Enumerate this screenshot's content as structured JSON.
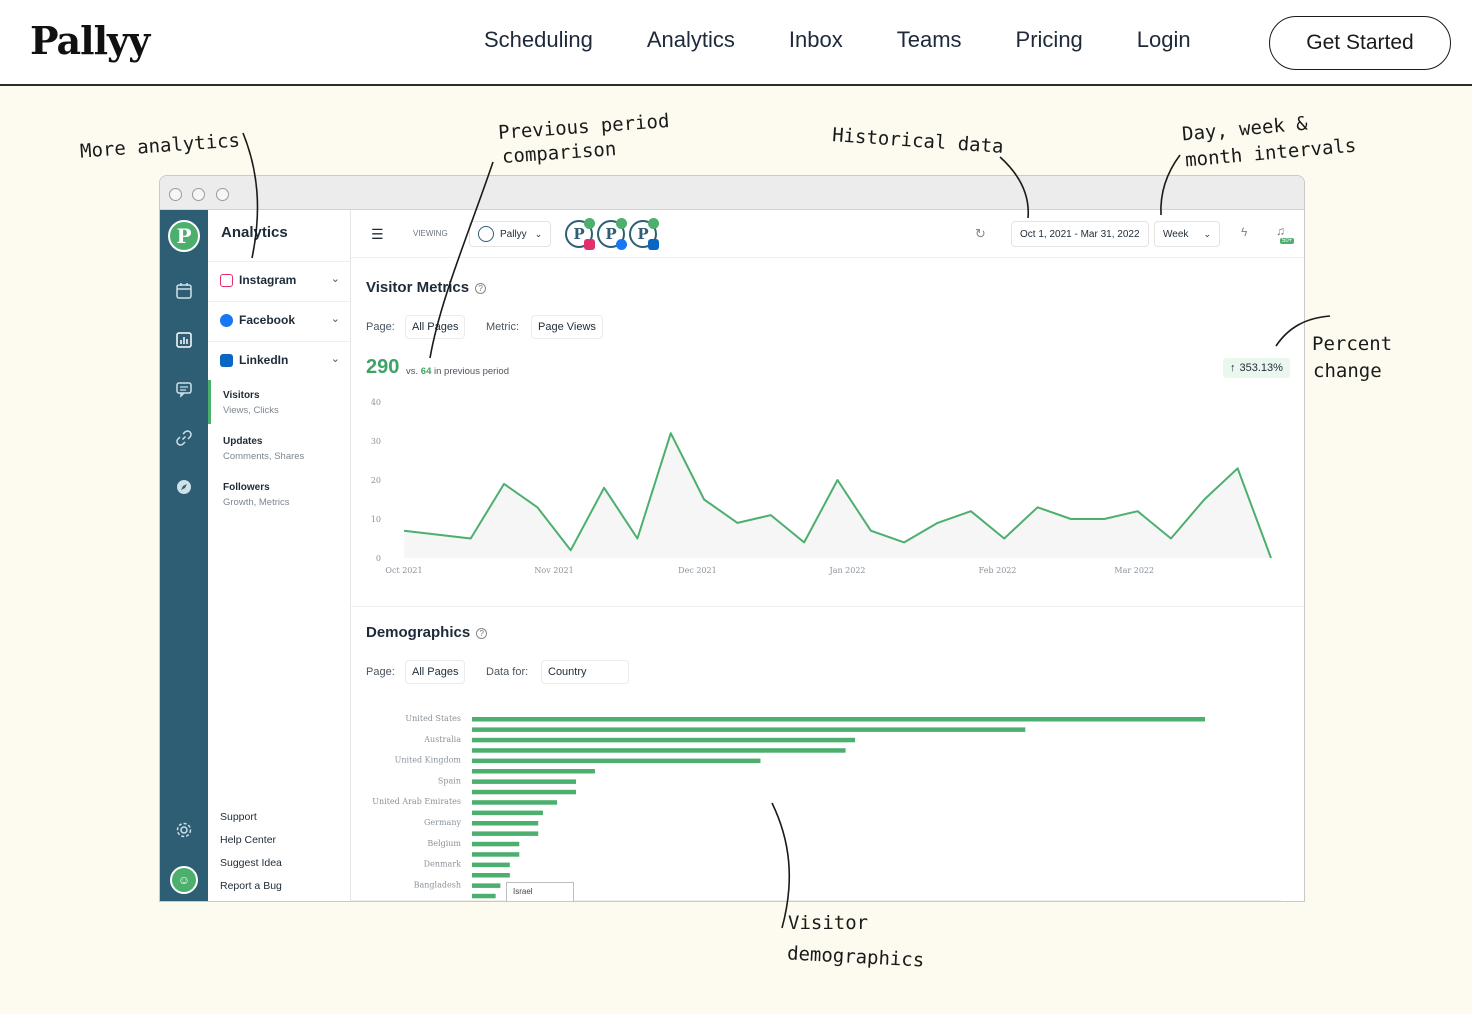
{
  "site": {
    "brand": "Pallyy",
    "nav": [
      "Scheduling",
      "Analytics",
      "Inbox",
      "Teams",
      "Pricing",
      "Login"
    ],
    "cta": "Get Started"
  },
  "annotations": {
    "more_analytics": "More analytics",
    "previous_period_1": "Previous period",
    "previous_period_2": "comparison",
    "historical": "Historical data",
    "intervals_1": "Day, week &",
    "intervals_2": "month intervals",
    "percent_1": "Percent",
    "percent_2": "change",
    "visitor_1": "Visitor",
    "visitor_2": "demographics"
  },
  "sidebar": {
    "title": "Analytics",
    "networks": [
      {
        "label": "Instagram",
        "color": "#e1306c"
      },
      {
        "label": "Facebook",
        "color": "#1877f2"
      },
      {
        "label": "LinkedIn",
        "color": "#0a66c2"
      }
    ],
    "linkedin_sub": [
      {
        "title": "Visitors",
        "subtitle": "Views, Clicks"
      },
      {
        "title": "Updates",
        "subtitle": "Comments, Shares"
      },
      {
        "title": "Followers",
        "subtitle": "Growth, Metrics"
      }
    ],
    "footer": [
      "Support",
      "Help Center",
      "Suggest Idea",
      "Report a Bug"
    ]
  },
  "toolbar": {
    "viewing": "VIEWING",
    "account": "Pallyy",
    "date_range": "Oct 1, 2021 - Mar 31, 2022",
    "interval": "Week",
    "notif_badge": "50+"
  },
  "visitor_metrics": {
    "title": "Visitor Metrics",
    "page_label": "Page:",
    "page_value": "All Pages",
    "metric_label": "Metric:",
    "metric_value": "Page Views",
    "total": "290",
    "vs_prefix": "vs.",
    "prev_value": "64",
    "vs_suffix": "in previous period",
    "percent_change": "353.13%"
  },
  "chart_data": [
    {
      "type": "area",
      "title": "",
      "x": [
        "Oct 2021",
        "",
        "",
        "",
        "",
        "Nov 2021",
        "",
        "",
        "",
        "",
        "Dec 2021",
        "",
        "",
        "",
        "",
        "Jan 2022",
        "",
        "",
        "",
        "",
        "Feb 2022",
        "",
        "",
        "",
        "",
        "Mar 2022",
        "",
        ""
      ],
      "x_ticks": [
        "Oct 2021",
        "Nov 2021",
        "Dec 2021",
        "Jan 2022",
        "Feb 2022",
        "Mar 2022"
      ],
      "values": [
        7,
        6,
        5,
        19,
        13,
        2,
        18,
        5,
        32,
        15,
        9,
        11,
        4,
        20,
        7,
        4,
        9,
        12,
        5,
        13,
        10,
        10,
        12,
        5,
        15,
        23,
        0
      ],
      "ylim": [
        0,
        40
      ],
      "y_ticks": [
        0,
        10,
        20,
        30,
        40
      ],
      "color": "#4caf6e"
    },
    {
      "type": "bar",
      "orientation": "horizontal",
      "categories": [
        "United States",
        "Australia",
        "United Kingdom",
        "Spain",
        "United Arab Emirates",
        "Germany",
        "Belgium",
        "Denmark",
        "Bangladesh",
        "Israel"
      ],
      "values": [
        155,
        117,
        81,
        79,
        61,
        26,
        22,
        22,
        18,
        15,
        14,
        14,
        10,
        10,
        8,
        8,
        6,
        5,
        5,
        6
      ],
      "color": "#4caf6e"
    }
  ],
  "demographics": {
    "title": "Demographics",
    "page_label": "Page:",
    "page_value": "All Pages",
    "data_label": "Data for:",
    "data_value": "Country",
    "tooltip": "Israel"
  }
}
